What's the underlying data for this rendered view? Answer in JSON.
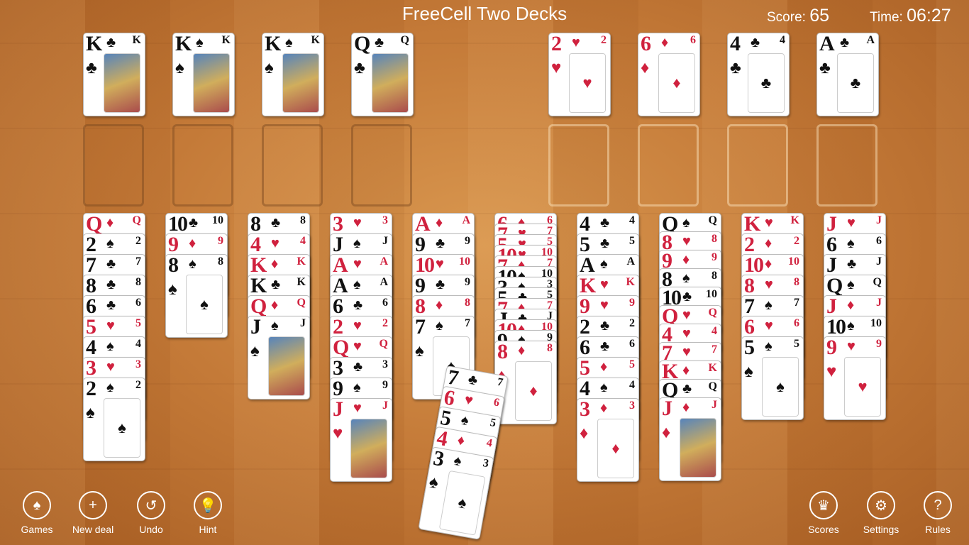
{
  "title": "FreeCell Two Decks",
  "score": {
    "label": "Score:",
    "value": "65"
  },
  "time": {
    "label": "Time:",
    "value": "06:27"
  },
  "colors": {
    "red": "#d0213e",
    "black": "#111111"
  },
  "top_left_cells": [
    [
      "K",
      "♣"
    ],
    [
      "K",
      "♠"
    ],
    [
      "K",
      "♠"
    ],
    [
      "Q",
      "♣"
    ]
  ],
  "top_right_cells": [
    [
      "2",
      "♥"
    ],
    [
      "6",
      "♦"
    ],
    [
      "4",
      "♣"
    ],
    [
      "A",
      "♣"
    ]
  ],
  "columns": [
    [
      [
        "Q",
        "♦"
      ],
      [
        "2",
        "♠"
      ],
      [
        "7",
        "♣"
      ],
      [
        "8",
        "♣"
      ],
      [
        "6",
        "♣"
      ],
      [
        "5",
        "♥"
      ],
      [
        "4",
        "♠"
      ],
      [
        "3",
        "♥"
      ],
      [
        "2",
        "♠"
      ]
    ],
    [
      [
        "10",
        "♣"
      ],
      [
        "9",
        "♦"
      ],
      [
        "8",
        "♠"
      ]
    ],
    [
      [
        "8",
        "♣"
      ],
      [
        "4",
        "♥"
      ],
      [
        "K",
        "♦"
      ],
      [
        "K",
        "♣"
      ],
      [
        "Q",
        "♦"
      ],
      [
        "J",
        "♠"
      ]
    ],
    [
      [
        "3",
        "♥"
      ],
      [
        "J",
        "♠"
      ],
      [
        "A",
        "♥"
      ],
      [
        "A",
        "♠"
      ],
      [
        "6",
        "♣"
      ],
      [
        "2",
        "♥"
      ],
      [
        "Q",
        "♥"
      ],
      [
        "3",
        "♣"
      ],
      [
        "9",
        "♠"
      ],
      [
        "J",
        "♥"
      ]
    ],
    [
      [
        "A",
        "♦"
      ],
      [
        "9",
        "♣"
      ],
      [
        "10",
        "♥"
      ],
      [
        "9",
        "♣"
      ],
      [
        "8",
        "♦"
      ],
      [
        "7",
        "♠"
      ]
    ],
    [
      [
        "6",
        "♦"
      ],
      [
        "7",
        "♥"
      ],
      [
        "5",
        "♥"
      ],
      [
        "10",
        "♥"
      ],
      [
        "7",
        "♦"
      ],
      [
        "10",
        "♠"
      ],
      [
        "3",
        "♠"
      ],
      [
        "5",
        "♣"
      ],
      [
        "7",
        "♦"
      ],
      [
        "J",
        "♣"
      ],
      [
        "10",
        "♦"
      ],
      [
        "9",
        "♠"
      ],
      [
        "8",
        "♦"
      ]
    ],
    [
      [
        "4",
        "♣"
      ],
      [
        "5",
        "♣"
      ],
      [
        "A",
        "♠"
      ],
      [
        "K",
        "♥"
      ],
      [
        "9",
        "♥"
      ],
      [
        "2",
        "♣"
      ],
      [
        "6",
        "♣"
      ],
      [
        "5",
        "♦"
      ],
      [
        "4",
        "♠"
      ],
      [
        "3",
        "♦"
      ]
    ],
    [
      [
        "Q",
        "♠"
      ],
      [
        "8",
        "♥"
      ],
      [
        "9",
        "♦"
      ],
      [
        "8",
        "♠"
      ],
      [
        "10",
        "♣"
      ],
      [
        "Q",
        "♥"
      ],
      [
        "4",
        "♥"
      ],
      [
        "7",
        "♥"
      ],
      [
        "K",
        "♦"
      ],
      [
        "Q",
        "♣"
      ],
      [
        "J",
        "♦"
      ]
    ],
    [
      [
        "K",
        "♥"
      ],
      [
        "2",
        "♦"
      ],
      [
        "10",
        "♦"
      ],
      [
        "8",
        "♥"
      ],
      [
        "7",
        "♠"
      ],
      [
        "6",
        "♥"
      ],
      [
        "5",
        "♠"
      ]
    ],
    [
      [
        "J",
        "♥"
      ],
      [
        "6",
        "♠"
      ],
      [
        "J",
        "♣"
      ],
      [
        "Q",
        "♠"
      ],
      [
        "J",
        "♦"
      ],
      [
        "10",
        "♠"
      ],
      [
        "9",
        "♥"
      ]
    ]
  ],
  "dragged": [
    [
      "7",
      "♣"
    ],
    [
      "6",
      "♥"
    ],
    [
      "5",
      "♠"
    ],
    [
      "4",
      "♦"
    ],
    [
      "3",
      "♠"
    ]
  ],
  "buttons_left": [
    {
      "label": "Games",
      "icon": "games-icon",
      "glyph": "♠"
    },
    {
      "label": "New deal",
      "icon": "plus-icon",
      "glyph": "+"
    },
    {
      "label": "Undo",
      "icon": "undo-icon",
      "glyph": "↺"
    },
    {
      "label": "Hint",
      "icon": "lightbulb-icon",
      "glyph": "💡"
    }
  ],
  "buttons_right": [
    {
      "label": "Scores",
      "icon": "crown-icon",
      "glyph": "♛"
    },
    {
      "label": "Settings",
      "icon": "gear-icon",
      "glyph": "⚙"
    },
    {
      "label": "Rules",
      "icon": "help-icon",
      "glyph": "?"
    }
  ]
}
